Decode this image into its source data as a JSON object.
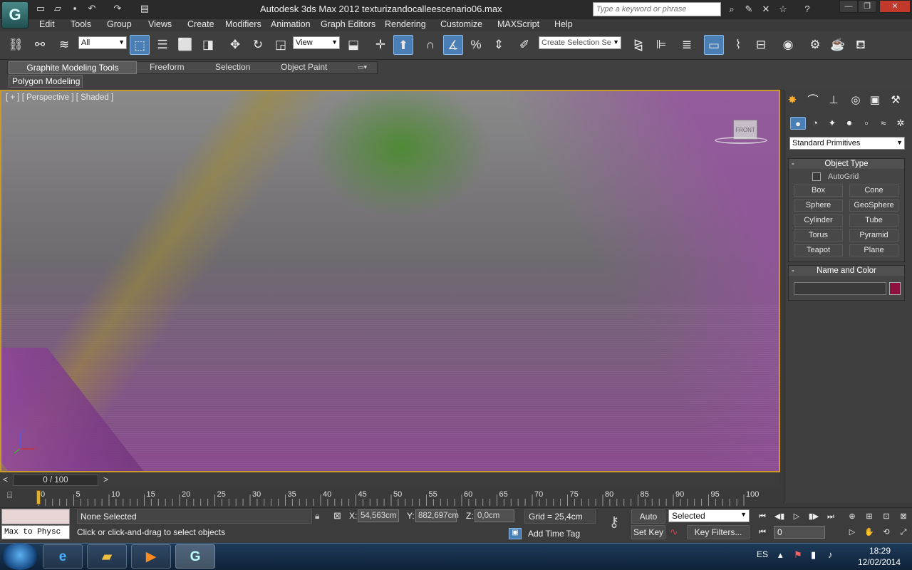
{
  "window": {
    "app_title": "Autodesk 3ds Max  2012",
    "file_name": "texturizandocalleescenario06.max",
    "search_placeholder": "Type a keyword or phrase"
  },
  "menu": [
    "Edit",
    "Tools",
    "Group",
    "Views",
    "Create",
    "Modifiers",
    "Animation",
    "Graph Editors",
    "Rendering",
    "Customize",
    "MAXScript",
    "Help"
  ],
  "toolbar": {
    "filter_value": "All",
    "ref_coord_value": "View",
    "selection_set_placeholder": "Create Selection Se"
  },
  "ribbon": {
    "tabs": [
      "Graphite Modeling Tools",
      "Freeform",
      "Selection",
      "Object Paint"
    ],
    "panel": "Polygon Modeling"
  },
  "viewport": {
    "label": "[ + ] [ Perspective ] [ Shaded ]"
  },
  "command_panel": {
    "category_value": "Standard Primitives",
    "object_type_title": "Object Type",
    "autogrid_label": "AutoGrid",
    "buttons": [
      "Box",
      "Cone",
      "Sphere",
      "GeoSphere",
      "Cylinder",
      "Tube",
      "Torus",
      "Pyramid",
      "Teapot",
      "Plane"
    ],
    "name_color_title": "Name and Color",
    "object_color": "#8c1040"
  },
  "timeline": {
    "frame_display": "0 / 100",
    "frame_fraction": 0,
    "ticks": [
      "0",
      "5",
      "10",
      "15",
      "20",
      "25",
      "30",
      "35",
      "40",
      "45",
      "50",
      "55",
      "60",
      "65",
      "70",
      "75",
      "80",
      "85",
      "90",
      "95",
      "100"
    ]
  },
  "status": {
    "listener_value": "Max to Physc",
    "selection_info": "None Selected",
    "prompt": "Click or click-and-drag to select objects",
    "x_label": "X:",
    "x_value": "54,563cm",
    "y_label": "Y:",
    "y_value": "882,697cm",
    "z_label": "Z:",
    "z_value": "0,0cm",
    "grid": "Grid = 25,4cm",
    "add_time_tag": "Add Time Tag",
    "auto_key": "Auto Key",
    "set_key": "Set Key",
    "key_filters": "Key Filters...",
    "selected_value": "Selected",
    "current_frame": "0"
  },
  "taskbar": {
    "lang": "ES",
    "time": "18:29",
    "date": "12/02/2014"
  }
}
